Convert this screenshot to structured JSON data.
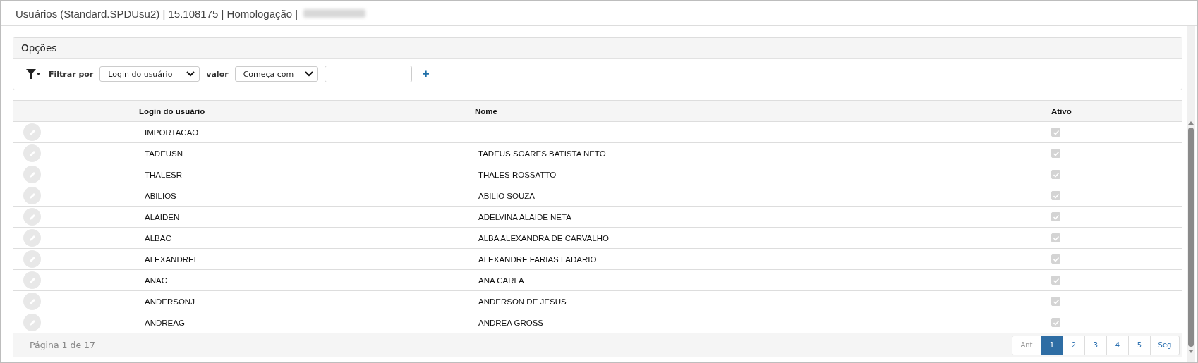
{
  "window": {
    "title": "Usuários (Standard.SPDUsu2) | 15.108175 | Homologação |"
  },
  "options": {
    "title": "Opções",
    "filter_label": "Filtrar por",
    "filter_field": "Login do usuário",
    "value_label": "valor",
    "operator": "Começa com",
    "add": "+"
  },
  "table": {
    "columns": [
      "Login do usuário",
      "Nome",
      "Ativo"
    ],
    "rows": [
      {
        "login": "IMPORTACAO",
        "active": true
      },
      {
        "login": "TADEUSN",
        "name": "TADEUS SOARES BATISTA NETO",
        "active": true
      },
      {
        "login": "THALESR",
        "name": "THALES ROSSATTO",
        "active": true
      },
      {
        "login": "ABILIOS",
        "name": "ABILIO SOUZA",
        "active": true
      },
      {
        "login": "ALAIDEN",
        "name": "ADELVINA ALAIDE NETA",
        "active": true
      },
      {
        "login": "ALBAC",
        "name": "ALBA ALEXANDRA DE CARVALHO",
        "active": true
      },
      {
        "login": "ALEXANDREL",
        "name": "ALEXANDRE FARIAS LADARIO",
        "active": true
      },
      {
        "login": "ANAC",
        "name": "ANA CARLA",
        "active": true
      },
      {
        "login": "ANDERSONJ",
        "name": "ANDERSON DE JESUS",
        "active": true
      },
      {
        "login": "ANDREAG",
        "name": "ANDREA GROSS",
        "active": true
      }
    ]
  },
  "pager": {
    "info": "Página 1 de 17",
    "pages": [
      {
        "label": "Ant",
        "kind": "prev",
        "selected": false
      },
      {
        "label": "1",
        "kind": "page",
        "selected": true
      },
      {
        "label": "2",
        "kind": "page",
        "selected": false
      },
      {
        "label": "3",
        "kind": "page",
        "selected": false
      },
      {
        "label": "4",
        "kind": "page",
        "selected": false
      },
      {
        "label": "5",
        "kind": "page",
        "selected": false
      },
      {
        "label": "Seg",
        "kind": "next",
        "selected": false
      }
    ]
  }
}
